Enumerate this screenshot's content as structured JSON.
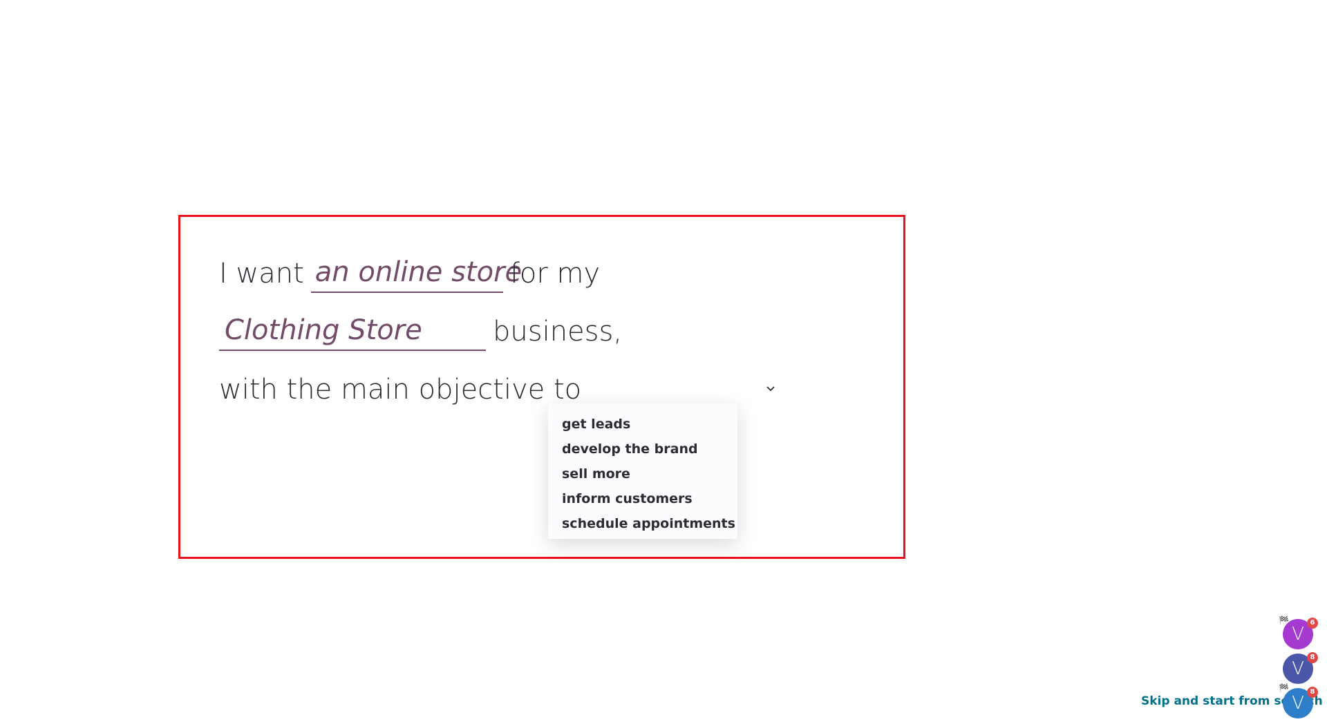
{
  "sentence": {
    "part_i_want": "I want",
    "website_type_value": "an online store",
    "part_for_my": "for my",
    "industry_value": "Clothing Store",
    "part_business": "business,",
    "part_objective": "with the main objective to"
  },
  "objective_dropdown": {
    "options": [
      "get leads",
      "develop the brand",
      "sell more",
      "inform customers",
      "schedule appointments"
    ]
  },
  "skip_link": "Skip and start from scratch",
  "avatars": [
    {
      "initial": "V",
      "badge": "6",
      "color": "#a43ad0"
    },
    {
      "initial": "V",
      "badge": "8",
      "color": "#4a57a8"
    },
    {
      "initial": "V",
      "badge": "8",
      "color": "#2e7ec9"
    }
  ],
  "colors": {
    "frame": "#e8121a",
    "accent": "#714b67",
    "link": "#01708a"
  }
}
